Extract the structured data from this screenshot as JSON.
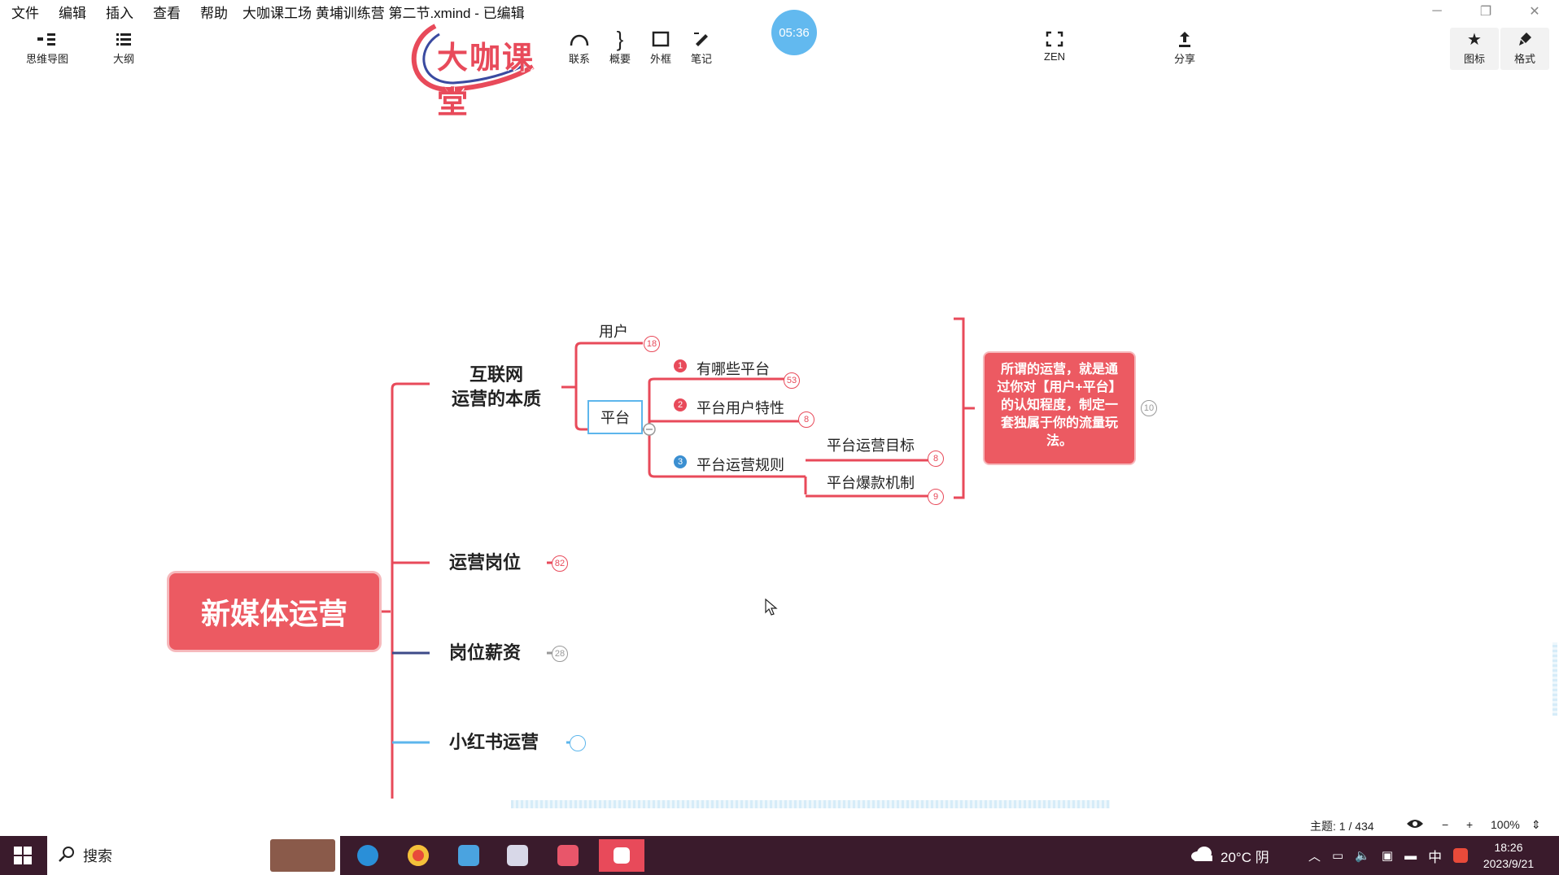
{
  "menubar": {
    "items": [
      "文件",
      "编辑",
      "插入",
      "查看",
      "帮助"
    ],
    "doc_title": "大咖课工场 黄埔训练营 第二节.xmind - 已编辑"
  },
  "toolbar": {
    "left": [
      {
        "label": "思维导图",
        "icon": "mindmap-icon"
      },
      {
        "label": "大纲",
        "icon": "outline-icon"
      }
    ],
    "mid": [
      {
        "label": "联系",
        "icon": "relationship-icon"
      },
      {
        "label": "概要",
        "icon": "summary-icon"
      },
      {
        "label": "外框",
        "icon": "boundary-icon"
      },
      {
        "label": "笔记",
        "icon": "note-icon"
      }
    ],
    "zen": {
      "label": "ZEN",
      "icon": "fullscreen-icon"
    },
    "share": {
      "label": "分享",
      "icon": "share-icon"
    },
    "right": [
      {
        "label": "图标",
        "icon": "star-icon"
      },
      {
        "label": "格式",
        "icon": "brush-icon"
      }
    ]
  },
  "logo_text": "大咖课堂",
  "timer": "05:36",
  "mindmap": {
    "root": "新媒体运营",
    "branch1": {
      "line1": "互联网",
      "line2": "运营的本质"
    },
    "user": {
      "label": "用户",
      "count": "18"
    },
    "platform": {
      "label": "平台"
    },
    "items": [
      {
        "num": "1",
        "label": "有哪些平台",
        "count": "53"
      },
      {
        "num": "2",
        "label": "平台用户特性",
        "count": "8"
      },
      {
        "num": "3",
        "label": "平台运营规则"
      }
    ],
    "rules": [
      {
        "label": "平台运营目标",
        "count": "8"
      },
      {
        "label": "平台爆款机制",
        "count": "9"
      }
    ],
    "callout": "所谓的运营，就是通过你对【用户+平台】的认知程度，制定一套独属于你的流量玩法。",
    "callout_count": "10",
    "branch2": {
      "label": "运营岗位",
      "count": "82"
    },
    "branch3": {
      "label": "岗位薪资",
      "count": "28"
    },
    "branch4": {
      "label": "小红书运营"
    }
  },
  "status": {
    "topic": "主题: 1 / 434",
    "zoom": "100%"
  },
  "taskbar": {
    "search": "搜索",
    "weather": "20°C 阴",
    "ime": "中",
    "time": "18:26",
    "date": "2023/9/21"
  },
  "colors": {
    "accent_red": "#ec5a62",
    "accent_blue": "#5db6ec",
    "taskbar": "#3a1b2c"
  }
}
